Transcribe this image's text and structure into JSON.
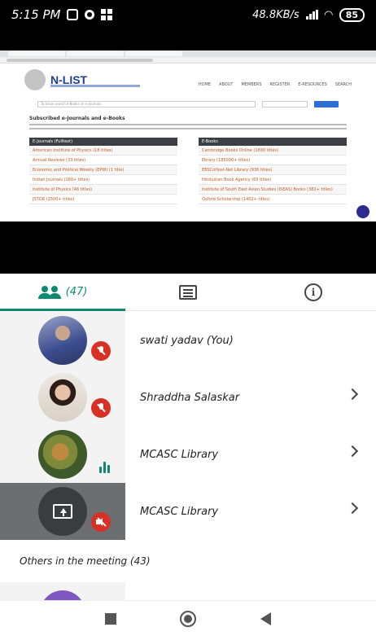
{
  "status_bar": {
    "time": "5:15 PM",
    "network_speed": "48.8KB/s",
    "battery": "85"
  },
  "shared_screen": {
    "site_title": "N-LIST",
    "nav_links": [
      "HOME",
      "ABOUT",
      "MEMBERS",
      "REGISTER",
      "E-RESOURCES",
      "SEARCH"
    ],
    "search_placeholder": "To know search e-Books or e-Journals",
    "heading": "Subscribed e-Journals and e-Books",
    "ejournals_header": "E-Journals (Fulltext)",
    "ebooks_header": "E-Books",
    "ejournals": [
      "American Institute of Physics (18 titles)",
      "Annual Reviews (33 titles)",
      "Economic and Political Weekly (EPW) (1 title)",
      "Indian Journals (180+ titles)",
      "Institute of Physics (46 titles)",
      "JSTOR (2500+ titles)"
    ],
    "ebooks": [
      "Cambridge Books Online (1800 titles)",
      "Ebrary (185000+ titles)",
      "EBSCoHost-Net Library (936 titles)",
      "Hindustan Book Agency (65 titles)",
      "Institute of South East Asian Studies (ISEAS) Books (382+ titles)",
      "Oxford Scholarship (1402+ titles)"
    ]
  },
  "tabs": {
    "people_count": "(47)"
  },
  "participants": [
    {
      "name": "swati yadav (You)",
      "status": "muted"
    },
    {
      "name": "Shraddha Salaskar",
      "status": "muted"
    },
    {
      "name": "MCASC Library",
      "status": "speaking"
    },
    {
      "name": "MCASC Library",
      "status": "presenting-audio-off"
    }
  ],
  "others_label": "Others in the meeting (43)",
  "colors": {
    "accent": "#0f8a72",
    "mute_red": "#d93025",
    "presenter_tile": "#6b6f72"
  }
}
